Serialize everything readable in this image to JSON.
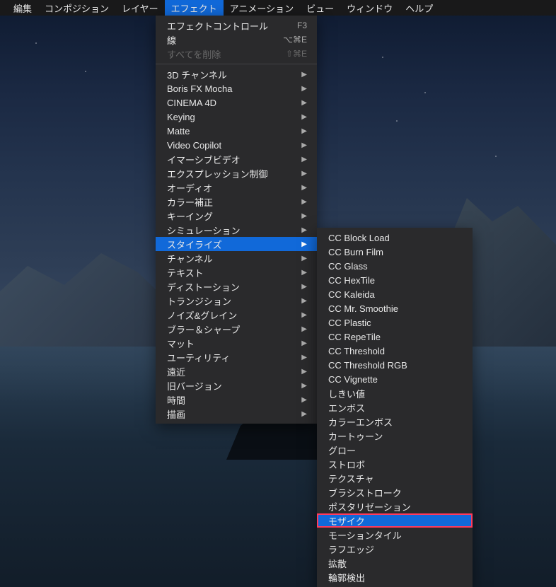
{
  "menubar": {
    "items": [
      {
        "label": "編集"
      },
      {
        "label": "コンポジション"
      },
      {
        "label": "レイヤー"
      },
      {
        "label": "エフェクト",
        "active": true
      },
      {
        "label": "アニメーション"
      },
      {
        "label": "ビュー"
      },
      {
        "label": "ウィンドウ"
      },
      {
        "label": "ヘルプ"
      }
    ]
  },
  "mainMenu": {
    "section1": [
      {
        "label": "エフェクトコントロール",
        "shortcut": "F3"
      },
      {
        "label": "線",
        "shortcut": "⌥⌘E"
      },
      {
        "label": "すべてを削除",
        "shortcut": "⇧⌘E",
        "disabled": true
      }
    ],
    "section2": [
      {
        "label": "3D チャンネル",
        "submenu": true
      },
      {
        "label": "Boris FX Mocha",
        "submenu": true
      },
      {
        "label": "CINEMA 4D",
        "submenu": true
      },
      {
        "label": "Keying",
        "submenu": true
      },
      {
        "label": "Matte",
        "submenu": true
      },
      {
        "label": "Video Copilot",
        "submenu": true
      },
      {
        "label": "イマーシブビデオ",
        "submenu": true
      },
      {
        "label": "エクスプレッション制御",
        "submenu": true
      },
      {
        "label": "オーディオ",
        "submenu": true
      },
      {
        "label": "カラー補正",
        "submenu": true
      },
      {
        "label": "キーイング",
        "submenu": true
      },
      {
        "label": "シミュレーション",
        "submenu": true
      },
      {
        "label": "スタイライズ",
        "submenu": true,
        "highlighted": true
      },
      {
        "label": "チャンネル",
        "submenu": true
      },
      {
        "label": "テキスト",
        "submenu": true
      },
      {
        "label": "ディストーション",
        "submenu": true
      },
      {
        "label": "トランジション",
        "submenu": true
      },
      {
        "label": "ノイズ&グレイン",
        "submenu": true
      },
      {
        "label": "ブラー＆シャープ",
        "submenu": true
      },
      {
        "label": "マット",
        "submenu": true
      },
      {
        "label": "ユーティリティ",
        "submenu": true
      },
      {
        "label": "遠近",
        "submenu": true
      },
      {
        "label": "旧バージョン",
        "submenu": true
      },
      {
        "label": "時間",
        "submenu": true
      },
      {
        "label": "描画",
        "submenu": true
      }
    ]
  },
  "subMenu": {
    "items": [
      {
        "label": "CC Block Load"
      },
      {
        "label": "CC Burn Film"
      },
      {
        "label": "CC Glass"
      },
      {
        "label": "CC HexTile"
      },
      {
        "label": "CC Kaleida"
      },
      {
        "label": "CC Mr. Smoothie"
      },
      {
        "label": "CC Plastic"
      },
      {
        "label": "CC RepeTile"
      },
      {
        "label": "CC Threshold"
      },
      {
        "label": "CC Threshold RGB"
      },
      {
        "label": "CC Vignette"
      },
      {
        "label": "しきい値"
      },
      {
        "label": "エンボス"
      },
      {
        "label": "カラーエンボス"
      },
      {
        "label": "カートゥーン"
      },
      {
        "label": "グロー"
      },
      {
        "label": "ストロボ"
      },
      {
        "label": "テクスチャ"
      },
      {
        "label": "ブラシストローク"
      },
      {
        "label": "ポスタリゼーション"
      },
      {
        "label": "モザイク",
        "annotated": true
      },
      {
        "label": "モーションタイル"
      },
      {
        "label": "ラフエッジ"
      },
      {
        "label": "拡散"
      },
      {
        "label": "輪郭検出"
      }
    ]
  }
}
